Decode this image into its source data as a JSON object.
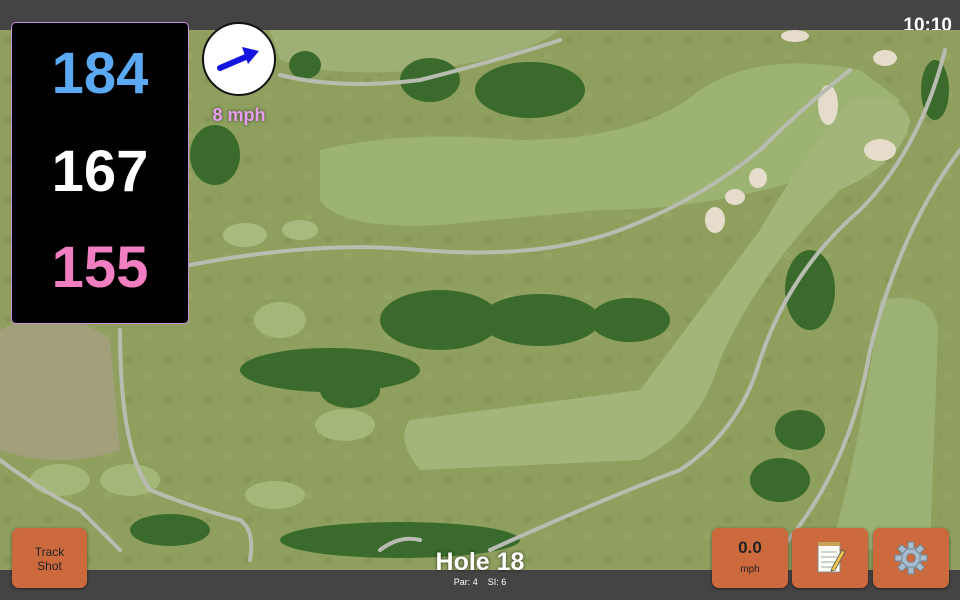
{
  "status": {
    "time": "10:10"
  },
  "yardage": {
    "back": "184",
    "center": "167",
    "front": "155"
  },
  "wind": {
    "speed": "8 mph",
    "icon": "wind-arrow-icon",
    "arrow_color": "#1414e0"
  },
  "hole": {
    "title": "Hole 18",
    "par": "Par: 4",
    "si": "SI: 6"
  },
  "buttons": {
    "track_shot_line1": "Track",
    "track_shot_line2": "Shot",
    "speed_value": "0.0",
    "speed_unit": "mph",
    "notes_icon": "notepad-icon",
    "settings_icon": "gear-icon"
  },
  "colors": {
    "back": "#5aa9f2",
    "center": "#ffffff",
    "front": "#f07ec0",
    "button": "#cc6a3d",
    "wind_label": "#e69ff0"
  }
}
